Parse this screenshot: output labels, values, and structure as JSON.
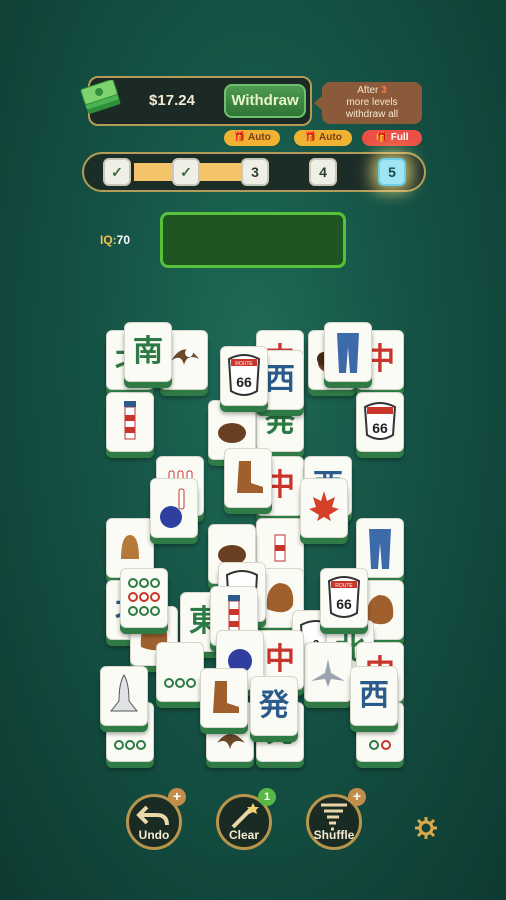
{
  "header": {
    "balance": "$17.24",
    "withdraw_label": "Withdraw",
    "info": {
      "line1_prefix": "After ",
      "count": "3",
      "line2": "more levels",
      "line3": "withdraw all"
    }
  },
  "progress": {
    "tags": [
      "Auto",
      "Auto",
      "Full"
    ],
    "steps": [
      "✓",
      "✓",
      "3",
      "4",
      "5"
    ],
    "current_step": 5
  },
  "iq": {
    "label": "IQ:",
    "value": "70"
  },
  "buttons": {
    "undo": "Undo",
    "clear": "Clear",
    "shuffle": "Shuffle",
    "clear_count": "1",
    "plus": "+"
  },
  "tiles": {
    "south": "南",
    "west": "西",
    "middle": "中",
    "east": "東",
    "north": "北",
    "bamboo": "発",
    "route": "66",
    "route_label": "ROUTE"
  },
  "colors": {
    "accent_gold": "#b39b5a",
    "green_button": "#4f9a52",
    "current_step": "#9fe6f4"
  }
}
